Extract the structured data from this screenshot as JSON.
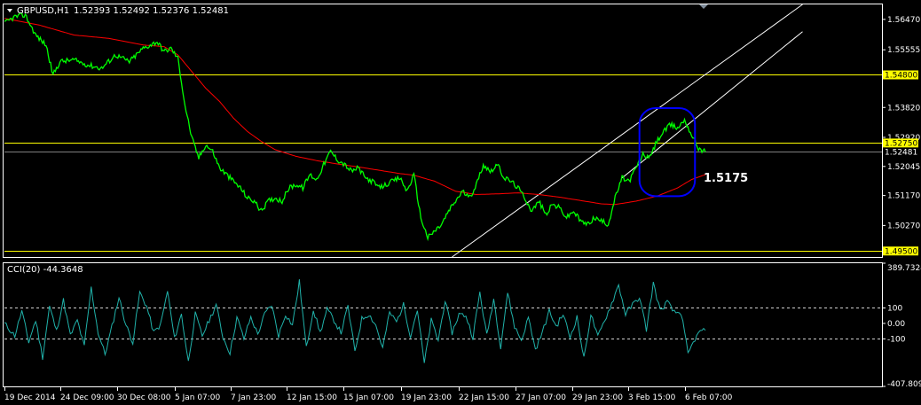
{
  "header": {
    "symbol": "GBPUSD,H1",
    "ohlc": "1.52393 1.52492 1.52376 1.52481",
    "menu_icon": "triangle-down-icon",
    "shift_marker_icon": "triangle-down-icon"
  },
  "indicator_header": {
    "text": "CCI(20) -44.3648"
  },
  "annotation": {
    "text": "1.5175",
    "highlight_color": "#0000ff"
  },
  "colors": {
    "background": "#000000",
    "price": "#00ff00",
    "moving_average": "#ff0000",
    "horizontal_levels": "#ffff00",
    "channel": "#ffffff",
    "cci": "#20b2aa",
    "grid_frame": "#ffffff"
  },
  "chart_data": [
    {
      "type": "line",
      "title": "GBPUSD,H1",
      "ylim": [
        1.4932,
        1.5692
      ],
      "y_ticks": [
        1.5647,
        1.55555,
        1.5382,
        1.5292,
        1.52045,
        1.5117,
        1.5027
      ],
      "y_tick_labels": [
        "1.56470",
        "1.55555",
        "1.53820",
        "1.52920",
        "1.52045",
        "1.51170",
        "1.50270"
      ],
      "x_labels": [
        "19 Dec 2014",
        "24 Dec 09:00",
        "30 Dec 08:00",
        "5 Jan 07:00",
        "7 Jan 23:00",
        "12 Jan 15:00",
        "15 Jan 07:00",
        "19 Jan 23:00",
        "22 Jan 15:00",
        "27 Jan 07:00",
        "29 Jan 23:00",
        "3 Feb 15:00",
        "6 Feb 07:00"
      ],
      "price_keypoints": [
        [
          0,
          1.5635
        ],
        [
          3,
          1.5655
        ],
        [
          6,
          1.566
        ],
        [
          9,
          1.56
        ],
        [
          12,
          1.557
        ],
        [
          14,
          1.548
        ],
        [
          16,
          1.552
        ],
        [
          20,
          1.5525
        ],
        [
          24,
          1.551
        ],
        [
          28,
          1.55
        ],
        [
          32,
          1.554
        ],
        [
          36,
          1.552
        ],
        [
          40,
          1.556
        ],
        [
          44,
          1.558
        ],
        [
          46,
          1.555
        ],
        [
          48,
          1.556
        ],
        [
          50,
          1.553
        ],
        [
          52,
          1.539
        ],
        [
          54,
          1.529
        ],
        [
          56,
          1.523
        ],
        [
          58,
          1.527
        ],
        [
          60,
          1.525
        ],
        [
          62,
          1.52
        ],
        [
          64,
          1.518
        ],
        [
          66,
          1.516
        ],
        [
          68,
          1.514
        ],
        [
          70,
          1.511
        ],
        [
          72,
          1.51
        ],
        [
          74,
          1.507
        ],
        [
          76,
          1.51
        ],
        [
          78,
          1.511
        ],
        [
          80,
          1.51
        ],
        [
          82,
          1.514
        ],
        [
          84,
          1.515
        ],
        [
          86,
          1.514
        ],
        [
          88,
          1.518
        ],
        [
          90,
          1.5165
        ],
        [
          92,
          1.521
        ],
        [
          94,
          1.525
        ],
        [
          96,
          1.5225
        ],
        [
          98,
          1.521
        ],
        [
          100,
          1.519
        ],
        [
          102,
          1.52
        ],
        [
          104,
          1.517
        ],
        [
          106,
          1.516
        ],
        [
          108,
          1.514
        ],
        [
          110,
          1.515
        ],
        [
          112,
          1.516
        ],
        [
          114,
          1.517
        ],
        [
          116,
          1.513
        ],
        [
          118,
          1.518
        ],
        [
          120,
          1.505
        ],
        [
          122,
          1.499
        ],
        [
          124,
          1.501
        ],
        [
          126,
          1.503
        ],
        [
          128,
          1.507
        ],
        [
          130,
          1.51
        ],
        [
          132,
          1.513
        ],
        [
          134,
          1.511
        ],
        [
          136,
          1.515
        ],
        [
          138,
          1.521
        ],
        [
          140,
          1.519
        ],
        [
          142,
          1.521
        ],
        [
          144,
          1.517
        ],
        [
          146,
          1.516
        ],
        [
          148,
          1.514
        ],
        [
          150,
          1.511
        ],
        [
          152,
          1.507
        ],
        [
          154,
          1.51
        ],
        [
          156,
          1.506
        ],
        [
          158,
          1.509
        ],
        [
          160,
          1.508
        ],
        [
          162,
          1.505
        ],
        [
          164,
          1.507
        ],
        [
          166,
          1.504
        ],
        [
          168,
          1.503
        ],
        [
          170,
          1.505
        ],
        [
          172,
          1.504
        ],
        [
          174,
          1.503
        ],
        [
          176,
          1.511
        ],
        [
          178,
          1.517
        ],
        [
          180,
          1.516
        ],
        [
          182,
          1.52
        ],
        [
          184,
          1.524
        ],
        [
          186,
          1.523
        ],
        [
          188,
          1.528
        ],
        [
          190,
          1.531
        ],
        [
          192,
          1.533
        ],
        [
          194,
          1.532
        ],
        [
          196,
          1.5345
        ],
        [
          198,
          1.53
        ],
        [
          200,
          1.526
        ],
        [
          202,
          1.5248
        ]
      ],
      "ma_keypoints": [
        [
          0,
          1.565
        ],
        [
          10,
          1.563
        ],
        [
          20,
          1.56
        ],
        [
          30,
          1.559
        ],
        [
          40,
          1.557
        ],
        [
          46,
          1.5565
        ],
        [
          50,
          1.554
        ],
        [
          54,
          1.549
        ],
        [
          58,
          1.544
        ],
        [
          62,
          1.54
        ],
        [
          66,
          1.535
        ],
        [
          70,
          1.531
        ],
        [
          74,
          1.528
        ],
        [
          78,
          1.5255
        ],
        [
          84,
          1.5235
        ],
        [
          90,
          1.5222
        ],
        [
          96,
          1.5212
        ],
        [
          102,
          1.5203
        ],
        [
          108,
          1.5193
        ],
        [
          114,
          1.5183
        ],
        [
          118,
          1.5178
        ],
        [
          124,
          1.516
        ],
        [
          130,
          1.513
        ],
        [
          136,
          1.512
        ],
        [
          142,
          1.5122
        ],
        [
          148,
          1.5125
        ],
        [
          154,
          1.512
        ],
        [
          160,
          1.5112
        ],
        [
          166,
          1.5102
        ],
        [
          172,
          1.5092
        ],
        [
          176,
          1.509
        ],
        [
          182,
          1.51
        ],
        [
          188,
          1.5115
        ],
        [
          194,
          1.514
        ],
        [
          198,
          1.5165
        ],
        [
          202,
          1.518
        ]
      ],
      "x_count": 203,
      "horizontal_levels": [
        {
          "value": 1.548,
          "label": "1.54800"
        },
        {
          "value": 1.5275,
          "label": "1.52750"
        },
        {
          "value": 1.52481,
          "label": "1.52481",
          "current": true
        },
        {
          "value": 1.495,
          "label": "1.49500"
        }
      ],
      "channel_lines": [
        {
          "x1": 129,
          "y1": 1.4932,
          "x2": 230,
          "y2": 1.5692
        },
        {
          "x1": 178,
          "y1": 1.517,
          "x2": 230,
          "y2": 1.561
        }
      ],
      "highlight": {
        "x_from": 183,
        "x_to": 199,
        "y_from": 1.538,
        "y_to": 1.5115
      }
    },
    {
      "type": "line",
      "title": "CCI(20) -44.3648",
      "ylim": [
        -407.8091,
        389.7324
      ],
      "y_ticks": [
        389.7324,
        100,
        0.0,
        -100,
        -407.8091
      ],
      "y_tick_labels": [
        "389.7324",
        "100",
        "0.00",
        "-100",
        "-407.8091"
      ],
      "levels": [
        100,
        -100
      ],
      "keypoints": [
        [
          0,
          0
        ],
        [
          3,
          -80
        ],
        [
          5,
          80
        ],
        [
          7,
          -120
        ],
        [
          9,
          20
        ],
        [
          11,
          -220
        ],
        [
          13,
          110
        ],
        [
          15,
          -50
        ],
        [
          17,
          150
        ],
        [
          19,
          -80
        ],
        [
          21,
          20
        ],
        [
          23,
          -150
        ],
        [
          25,
          230
        ],
        [
          27,
          -60
        ],
        [
          29,
          -200
        ],
        [
          31,
          -20
        ],
        [
          33,
          170
        ],
        [
          35,
          -10
        ],
        [
          37,
          -120
        ],
        [
          39,
          200
        ],
        [
          41,
          110
        ],
        [
          43,
          -60
        ],
        [
          45,
          -10
        ],
        [
          47,
          210
        ],
        [
          49,
          -100
        ],
        [
          51,
          60
        ],
        [
          53,
          -250
        ],
        [
          55,
          60
        ],
        [
          57,
          -80
        ],
        [
          59,
          20
        ],
        [
          61,
          120
        ],
        [
          63,
          -90
        ],
        [
          65,
          -190
        ],
        [
          67,
          40
        ],
        [
          69,
          -100
        ],
        [
          71,
          40
        ],
        [
          73,
          -70
        ],
        [
          75,
          60
        ],
        [
          77,
          120
        ],
        [
          79,
          -80
        ],
        [
          81,
          60
        ],
        [
          83,
          -10
        ],
        [
          85,
          270
        ],
        [
          87,
          -160
        ],
        [
          89,
          90
        ],
        [
          91,
          -60
        ],
        [
          93,
          90
        ],
        [
          95,
          20
        ],
        [
          97,
          -60
        ],
        [
          99,
          110
        ],
        [
          101,
          -180
        ],
        [
          103,
          30
        ],
        [
          105,
          60
        ],
        [
          107,
          -10
        ],
        [
          109,
          -160
        ],
        [
          111,
          70
        ],
        [
          113,
          10
        ],
        [
          115,
          120
        ],
        [
          117,
          -80
        ],
        [
          119,
          90
        ],
        [
          121,
          -260
        ],
        [
          123,
          20
        ],
        [
          125,
          -110
        ],
        [
          127,
          150
        ],
        [
          129,
          -60
        ],
        [
          131,
          60
        ],
        [
          133,
          50
        ],
        [
          135,
          -90
        ],
        [
          137,
          200
        ],
        [
          139,
          -80
        ],
        [
          141,
          160
        ],
        [
          143,
          -150
        ],
        [
          145,
          200
        ],
        [
          147,
          -20
        ],
        [
          149,
          -110
        ],
        [
          151,
          40
        ],
        [
          153,
          -170
        ],
        [
          155,
          -60
        ],
        [
          157,
          80
        ],
        [
          159,
          -20
        ],
        [
          161,
          60
        ],
        [
          163,
          -90
        ],
        [
          165,
          40
        ],
        [
          167,
          -230
        ],
        [
          169,
          60
        ],
        [
          171,
          -90
        ],
        [
          173,
          20
        ],
        [
          175,
          130
        ],
        [
          177,
          250
        ],
        [
          179,
          60
        ],
        [
          181,
          120
        ],
        [
          183,
          170
        ],
        [
          185,
          -40
        ],
        [
          187,
          260
        ],
        [
          189,
          80
        ],
        [
          191,
          140
        ],
        [
          193,
          70
        ],
        [
          195,
          70
        ],
        [
          197,
          -200
        ],
        [
          199,
          -100
        ],
        [
          201,
          -40
        ],
        [
          202,
          -44.36
        ]
      ]
    }
  ]
}
